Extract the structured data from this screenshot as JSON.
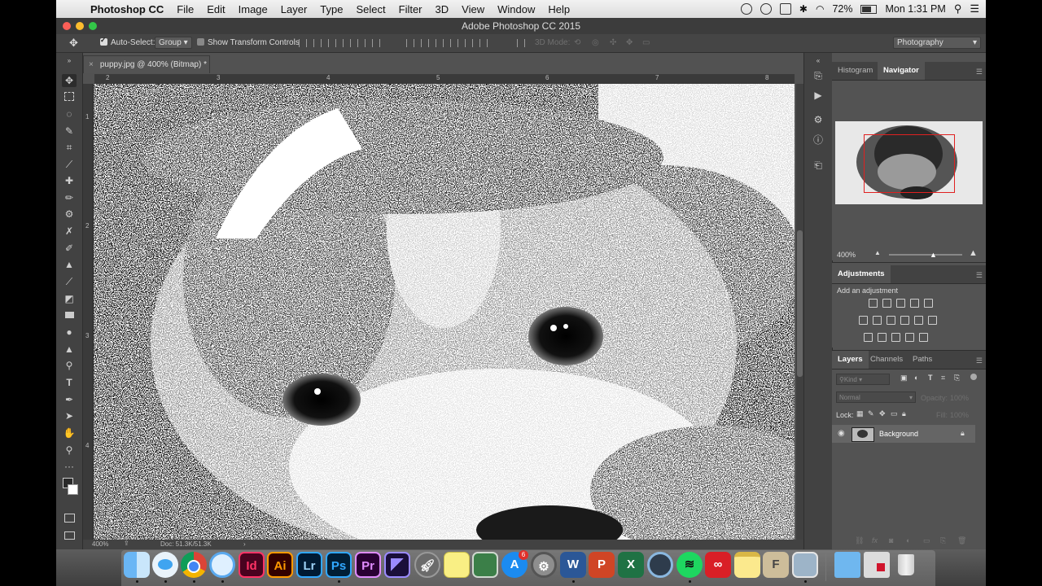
{
  "menubar": {
    "app_name": "Photoshop CC",
    "items": [
      "File",
      "Edit",
      "Image",
      "Layer",
      "Type",
      "Select",
      "Filter",
      "3D",
      "View",
      "Window",
      "Help"
    ],
    "battery": "72%",
    "clock": "Mon 1:31 PM"
  },
  "window": {
    "title": "Adobe Photoshop CC 2015"
  },
  "options": {
    "auto_select_label": "Auto-Select:",
    "auto_select_value": "Group",
    "show_transform_label": "Show Transform Controls",
    "mode_3d_label": "3D Mode:",
    "workspace": "Photography"
  },
  "document": {
    "tab_title": "puppy.jpg @ 400% (Bitmap) *",
    "zoom": "400%",
    "doc_size": "Doc: 51.3K/51.3K",
    "ruler_top": [
      "2",
      "3",
      "4",
      "5",
      "6",
      "7",
      "8"
    ],
    "ruler_left": [
      "1",
      "2",
      "3",
      "4"
    ]
  },
  "navigator": {
    "tabs": [
      "Histogram",
      "Navigator"
    ],
    "zoom": "400%"
  },
  "adjustments": {
    "title": "Adjustments",
    "subtitle": "Add an adjustment"
  },
  "layers": {
    "tabs": [
      "Layers",
      "Channels",
      "Paths"
    ],
    "filter_kind": "Kind",
    "blend_mode": "Normal",
    "opacity_label": "Opacity:",
    "opacity_value": "100%",
    "lock_label": "Lock:",
    "fill_label": "Fill:",
    "fill_value": "100%",
    "layer_name": "Background"
  },
  "dock": {
    "apps": [
      "Finder",
      "Messages",
      "Chrome",
      "Safari",
      "InDesign",
      "Illustrator",
      "Lightroom",
      "Photoshop",
      "Premiere",
      "Media Encoder",
      "Launchpad",
      "Stickies",
      "Preview",
      "App Store",
      "System Preferences",
      "Word",
      "PowerPoint",
      "Excel",
      "QuickTime",
      "Spotify",
      "Creative Cloud",
      "Notes",
      "Font Book",
      "Image Capture",
      "Downloads",
      "InDesign Doc",
      "Trash"
    ],
    "labels": {
      "Id": "Id",
      "Ai": "Ai",
      "Lr": "Lr",
      "Ps": "Ps",
      "Pr": "Pr",
      "W": "W",
      "P": "P",
      "X": "X"
    },
    "app_store_badge": "6"
  }
}
